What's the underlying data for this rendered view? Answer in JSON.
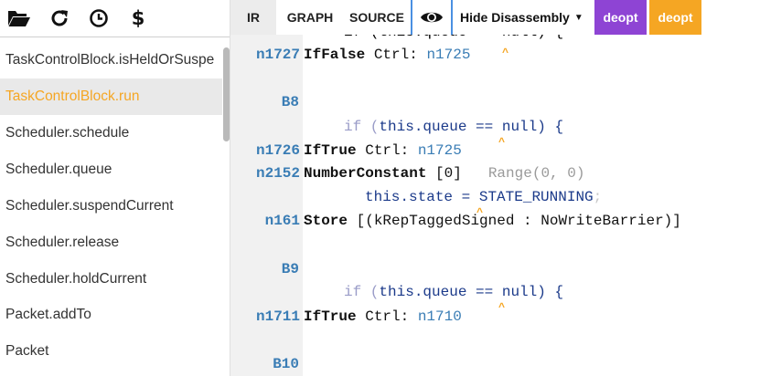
{
  "left_toolbar": {
    "icons": [
      {
        "name": "folder-open-icon"
      },
      {
        "name": "refresh-icon"
      },
      {
        "name": "clock-icon"
      },
      {
        "name": "dollar-icon",
        "glyph": "$"
      }
    ]
  },
  "function_list": {
    "selected_index": 1,
    "items": [
      "TaskControlBlock.isHeldOrSuspe",
      "TaskControlBlock.run",
      "Scheduler.schedule",
      "Scheduler.queue",
      "Scheduler.suspendCurrent",
      "Scheduler.release",
      "Scheduler.holdCurrent",
      "Packet.addTo",
      "Packet"
    ]
  },
  "right_toolbar": {
    "tabs": [
      "IR",
      "GRAPH",
      "SOURCE"
    ],
    "active_tab": "IR",
    "toggle_icon": "eye-icon",
    "disassembly_label": "Hide Disassembly",
    "deopt_buttons": [
      {
        "label": "deopt",
        "color": "#8e44d4"
      },
      {
        "label": "deopt",
        "color": "#f5a623"
      }
    ]
  },
  "code": {
    "lines": [
      {
        "type": "partial_source",
        "text": "if (this.queue == null) {"
      },
      {
        "type": "ir",
        "num": "n1727",
        "name": "IfFalse",
        "rest_plain": " Ctrl: ",
        "ref": "n1725"
      },
      {
        "type": "block",
        "label": "B8"
      },
      {
        "type": "source",
        "pre": "if (",
        "this": "this",
        "mid": ".queue ",
        "opr": "==",
        "post": " null) {"
      },
      {
        "type": "ir",
        "num": "n1726",
        "name": "IfTrue",
        "rest_plain": " Ctrl: ",
        "ref": "n1725"
      },
      {
        "type": "ir_const",
        "num": "n2152",
        "name": "NumberConstant",
        "rest_plain": " [0]",
        "range": "Range(0, 0)"
      },
      {
        "type": "source_assign",
        "this": "this",
        "mid": ".state ",
        "opr": "=",
        "post": " STATE_RUNNING",
        "tail": ";"
      },
      {
        "type": "ir_store",
        "num": "n161",
        "name": "Store",
        "rest_plain": " [(kRepTaggedSigned : NoWriteBarrier)]"
      },
      {
        "type": "block",
        "label": "B9"
      },
      {
        "type": "source",
        "pre": "if (",
        "this": "this",
        "mid": ".queue ",
        "opr": "==",
        "post": " null) {"
      },
      {
        "type": "ir",
        "num": "n1711",
        "name": "IfTrue",
        "rest_plain": " Ctrl: ",
        "ref": "n1710"
      },
      {
        "type": "block",
        "label": "B10"
      }
    ]
  }
}
